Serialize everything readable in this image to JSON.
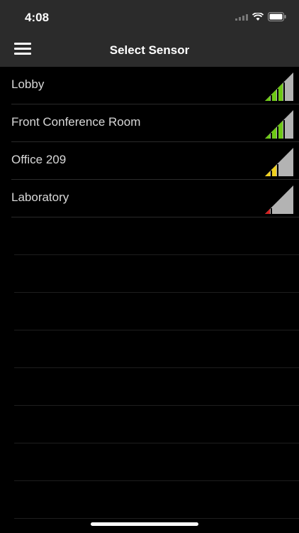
{
  "status_bar": {
    "time": "4:08"
  },
  "nav": {
    "title": "Select Sensor"
  },
  "sensors": [
    {
      "name": "Lobby",
      "signal_bars": 3,
      "color": "#6ec816"
    },
    {
      "name": "Front Conference Room",
      "signal_bars": 3,
      "color": "#6ec816"
    },
    {
      "name": "Office 209",
      "signal_bars": 2,
      "color": "#f0d020"
    },
    {
      "name": "Laboratory",
      "signal_bars": 1,
      "color": "#d62020"
    }
  ],
  "colors": {
    "bar_bg": "#b3b3b3",
    "header_bg": "#2b2b2b"
  }
}
